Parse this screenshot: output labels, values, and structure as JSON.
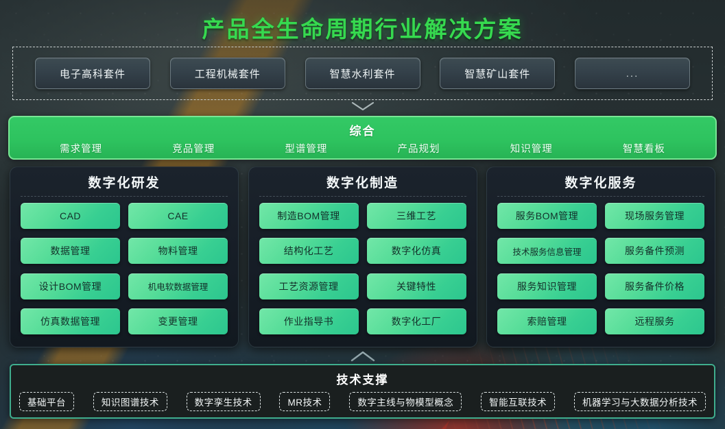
{
  "title": "产品全生命周期行业解决方案",
  "suites": {
    "items": [
      {
        "label": "电子高科套件"
      },
      {
        "label": "工程机械套件"
      },
      {
        "label": "智慧水利套件"
      },
      {
        "label": "智慧矿山套件"
      },
      {
        "label": "..."
      }
    ]
  },
  "comprehensive": {
    "title": "综合",
    "items": [
      {
        "label": "需求管理"
      },
      {
        "label": "竞品管理"
      },
      {
        "label": "型谱管理"
      },
      {
        "label": "产品规划"
      },
      {
        "label": "知识管理"
      },
      {
        "label": "智慧看板"
      }
    ]
  },
  "panels": [
    {
      "title": "数字化研发",
      "cells": [
        {
          "label": "CAD"
        },
        {
          "label": "CAE"
        },
        {
          "label": "数据管理"
        },
        {
          "label": "物料管理"
        },
        {
          "label": "设计BOM管理"
        },
        {
          "label": "机电软数据管理"
        },
        {
          "label": "仿真数据管理"
        },
        {
          "label": "变更管理"
        }
      ]
    },
    {
      "title": "数字化制造",
      "cells": [
        {
          "label": "制造BOM管理"
        },
        {
          "label": "三维工艺"
        },
        {
          "label": "结构化工艺"
        },
        {
          "label": "数字化仿真"
        },
        {
          "label": "工艺资源管理"
        },
        {
          "label": "关键特性"
        },
        {
          "label": "作业指导书"
        },
        {
          "label": "数字化工厂"
        }
      ]
    },
    {
      "title": "数字化服务",
      "cells": [
        {
          "label": "服务BOM管理"
        },
        {
          "label": "现场服务管理"
        },
        {
          "label": "技术服务信息管理"
        },
        {
          "label": "服务备件预测"
        },
        {
          "label": "服务知识管理"
        },
        {
          "label": "服务备件价格"
        },
        {
          "label": "索赔管理"
        },
        {
          "label": "远程服务"
        }
      ]
    }
  ],
  "support": {
    "title": "技术支撑",
    "tags": [
      {
        "label": "基础平台"
      },
      {
        "label": "知识图谱技术"
      },
      {
        "label": "数字孪生技术"
      },
      {
        "label": "MR技术"
      },
      {
        "label": "数字主线与物模型概念"
      },
      {
        "label": "智能互联技术"
      },
      {
        "label": "机器学习与大数据分析技术"
      }
    ]
  },
  "colors": {
    "title_green": "#36d94f",
    "band_green": "#2ec35f",
    "cell_green": "#4fdb9a",
    "panel_bg": "#161d26",
    "support_border": "#3fae8e"
  }
}
